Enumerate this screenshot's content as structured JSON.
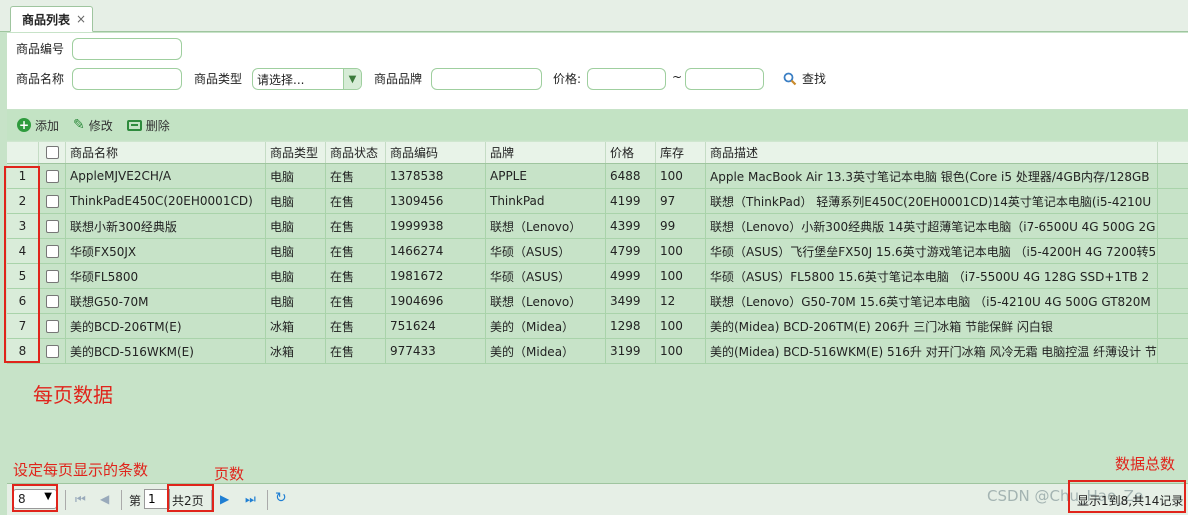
{
  "tab": {
    "title": "商品列表",
    "close": "×"
  },
  "filters": {
    "code_label": "商品编号",
    "name_label": "商品名称",
    "type_label": "商品类型",
    "type_selected": "请选择...",
    "brand_label": "商品品牌",
    "price_label": "价格:",
    "price_sep": "~",
    "search_label": "查找"
  },
  "toolbar": {
    "add": "添加",
    "edit": "修改",
    "delete": "删除"
  },
  "grid": {
    "columns": [
      "商品名称",
      "商品类型",
      "商品状态",
      "商品编码",
      "品牌",
      "价格",
      "库存",
      "商品描述"
    ],
    "rows": [
      {
        "n": "1",
        "name": "AppleMJVE2CH/A",
        "type": "电脑",
        "status": "在售",
        "code": "1378538",
        "brand": "APPLE",
        "price": "6488",
        "stock": "100",
        "desc": "Apple MacBook Air 13.3英寸笔记本电脑 银色(Core i5 处理器/4GB内存/128GB"
      },
      {
        "n": "2",
        "name": "ThinkPadE450C(20EH0001CD)",
        "type": "电脑",
        "status": "在售",
        "code": "1309456",
        "brand": "ThinkPad",
        "price": "4199",
        "stock": "97",
        "desc": "联想（ThinkPad） 轻薄系列E450C(20EH0001CD)14英寸笔记本电脑(i5-4210U"
      },
      {
        "n": "3",
        "name": "联想小新300经典版",
        "type": "电脑",
        "status": "在售",
        "code": "1999938",
        "brand": "联想（Lenovo）",
        "price": "4399",
        "stock": "99",
        "desc": "联想（Lenovo）小新300经典版 14英寸超薄笔记本电脑（i7-6500U 4G 500G 2G"
      },
      {
        "n": "4",
        "name": "华硕FX50JX",
        "type": "电脑",
        "status": "在售",
        "code": "1466274",
        "brand": "华硕（ASUS）",
        "price": "4799",
        "stock": "100",
        "desc": "华硕（ASUS）飞行堡垒FX50J 15.6英寸游戏笔记本电脑 （i5-4200H 4G 7200转5"
      },
      {
        "n": "5",
        "name": "华硕FL5800",
        "type": "电脑",
        "status": "在售",
        "code": "1981672",
        "brand": "华硕（ASUS）",
        "price": "4999",
        "stock": "100",
        "desc": "华硕（ASUS）FL5800 15.6英寸笔记本电脑 （i7-5500U 4G 128G SSD+1TB 2"
      },
      {
        "n": "6",
        "name": "联想G50-70M",
        "type": "电脑",
        "status": "在售",
        "code": "1904696",
        "brand": "联想（Lenovo）",
        "price": "3499",
        "stock": "12",
        "desc": "联想（Lenovo）G50-70M 15.6英寸笔记本电脑 （i5-4210U 4G 500G GT820M"
      },
      {
        "n": "7",
        "name": "美的BCD-206TM(E)",
        "type": "冰箱",
        "status": "在售",
        "code": "751624",
        "brand": "美的（Midea）",
        "price": "1298",
        "stock": "100",
        "desc": "美的(Midea) BCD-206TM(E) 206升 三门冰箱 节能保鲜 闪白银"
      },
      {
        "n": "8",
        "name": "美的BCD-516WKM(E)",
        "type": "冰箱",
        "status": "在售",
        "code": "977433",
        "brand": "美的（Midea）",
        "price": "3199",
        "stock": "100",
        "desc": "美的(Midea) BCD-516WKM(E) 516升 对开门冰箱 风冷无霜 电脑控温 纤薄设计 节"
      }
    ]
  },
  "annotations": {
    "per_page_data": "每页数据",
    "set_page_size": "设定每页显示的条数",
    "pages": "页数",
    "total_count": "数据总数"
  },
  "pager": {
    "page_size": "8",
    "page_prefix": "第",
    "page_value": "1",
    "page_total": "共2页",
    "summary": "显示1到8,共14记录"
  },
  "watermark": "CSDN @Chu_Hao_Ze",
  "colors": {
    "bg": "#c7e3c8",
    "accent": "#2e9b3d",
    "annotation": "#e0241b"
  }
}
